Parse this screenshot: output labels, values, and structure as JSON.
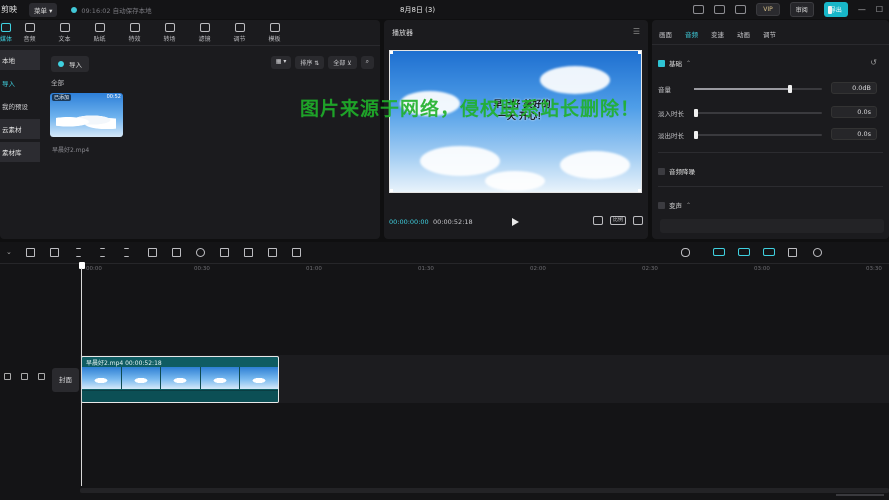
{
  "titlebar": {
    "app_name": "剪映",
    "menu_label": "菜单",
    "save_status": "09:16:02 自动保存本地",
    "project_title": "8月8日 (3)",
    "vip_label": "VIP",
    "review_label": "审阅",
    "export_label": "导出"
  },
  "asset_tabs": [
    {
      "label": "媒体",
      "icon": "media-icon"
    },
    {
      "label": "音频",
      "icon": "audio-icon"
    },
    {
      "label": "文本",
      "icon": "text-icon"
    },
    {
      "label": "贴纸",
      "icon": "sticker-icon"
    },
    {
      "label": "特效",
      "icon": "effects-icon"
    },
    {
      "label": "转场",
      "icon": "transition-icon"
    },
    {
      "label": "滤镜",
      "icon": "filter-icon"
    },
    {
      "label": "调节",
      "icon": "adjust-icon"
    },
    {
      "label": "模板",
      "icon": "template-icon"
    }
  ],
  "side_nav": [
    "本地",
    "导入",
    "我的预设",
    "云素材",
    "素材库"
  ],
  "media": {
    "import_label": "导入",
    "all_label": "全部",
    "sort_label": "排序",
    "filter_label": "全部",
    "thumb_badge": "已添加",
    "thumb_duration": "00:52",
    "file_name": "早晨好2.mp4"
  },
  "player": {
    "title": "播放器",
    "caption": "早上好 美好的一天 开心！",
    "time_current": "00:00:00:00",
    "time_total": "00:00:52:18",
    "ratio_label": "比例"
  },
  "props": {
    "tabs": [
      "画面",
      "音频",
      "变速",
      "动画",
      "调节"
    ],
    "active_tab": 1,
    "basic_label": "基础",
    "volume_label": "音量",
    "volume_value": "0.0dB",
    "volume_fraction": 0.75,
    "fadein_label": "淡入时长",
    "fadein_value": "0.0s",
    "fadeout_label": "淡出时长",
    "fadeout_value": "0.0s",
    "denoise_label": "音频降噪",
    "voice_change_label": "变声"
  },
  "watermark": "图片来源于网络，侵权联系站长删除！",
  "timeline": {
    "ruler_labels": [
      "00:00",
      "00:30",
      "01:00",
      "01:30",
      "02:00",
      "02:30",
      "03:00",
      "03:30"
    ],
    "cover_label": "封面",
    "clip_label": "早晨好2.mp4  00:00:52:18"
  },
  "colors": {
    "accent": "#3fd1e0",
    "export": "#18b6c8",
    "watermark": "#1fb12a",
    "clip": "#0f5c62"
  }
}
